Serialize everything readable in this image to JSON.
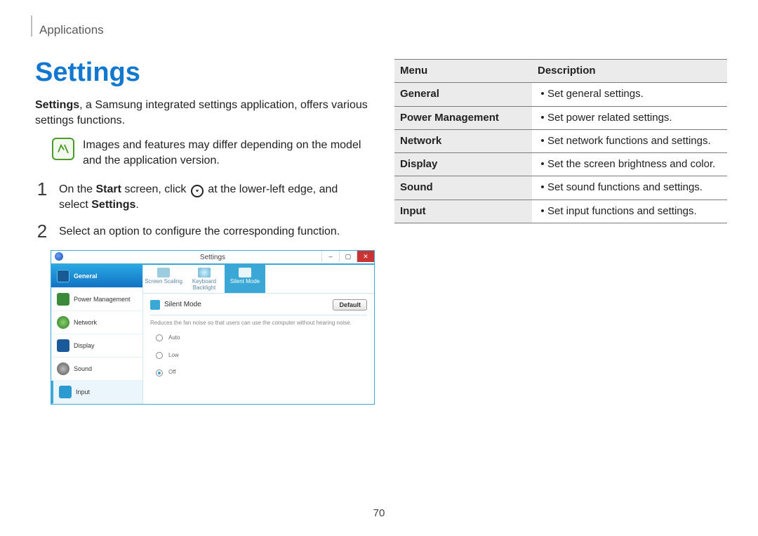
{
  "header": {
    "title": "Applications"
  },
  "page_number": "70",
  "section_title": "Settings",
  "intro": {
    "lead_bold": "Settings",
    "lead_rest": ", a Samsung integrated settings application, offers various settings functions."
  },
  "note": {
    "text": "Images and features may differ depending on the model and the application version."
  },
  "steps": {
    "s1_num": "1",
    "s1_a": "On the ",
    "s1_bold1": "Start",
    "s1_b": " screen, click ",
    "s1_c": " at the lower-left edge, and select ",
    "s1_bold2": "Settings",
    "s1_d": ".",
    "s2_num": "2",
    "s2_text": "Select an option to configure the corresponding function."
  },
  "app": {
    "title": "Settings",
    "sidebar": [
      {
        "label": "General"
      },
      {
        "label": "Power Management"
      },
      {
        "label": "Network"
      },
      {
        "label": "Display"
      },
      {
        "label": "Sound"
      },
      {
        "label": "Input"
      }
    ],
    "tabs": [
      {
        "label": "Screen Scaling"
      },
      {
        "label": "Keyboard Backlight"
      },
      {
        "label": "Silent Mode"
      }
    ],
    "content": {
      "title": "Silent Mode",
      "default_btn": "Default",
      "desc": "Reduces the fan noise so that users can use the computer without hearing noise.",
      "radios": [
        {
          "label": "Auto"
        },
        {
          "label": "Low"
        },
        {
          "label": "Off"
        }
      ]
    }
  },
  "table": {
    "headers": {
      "menu": "Menu",
      "desc": "Description"
    },
    "rows": [
      {
        "menu": "General",
        "desc": "Set general settings."
      },
      {
        "menu": "Power Management",
        "desc": "Set power related settings."
      },
      {
        "menu": "Network",
        "desc": "Set network functions and settings."
      },
      {
        "menu": "Display",
        "desc": "Set the screen brightness and color."
      },
      {
        "menu": "Sound",
        "desc": "Set sound functions and settings."
      },
      {
        "menu": "Input",
        "desc": "Set input functions and settings."
      }
    ]
  }
}
